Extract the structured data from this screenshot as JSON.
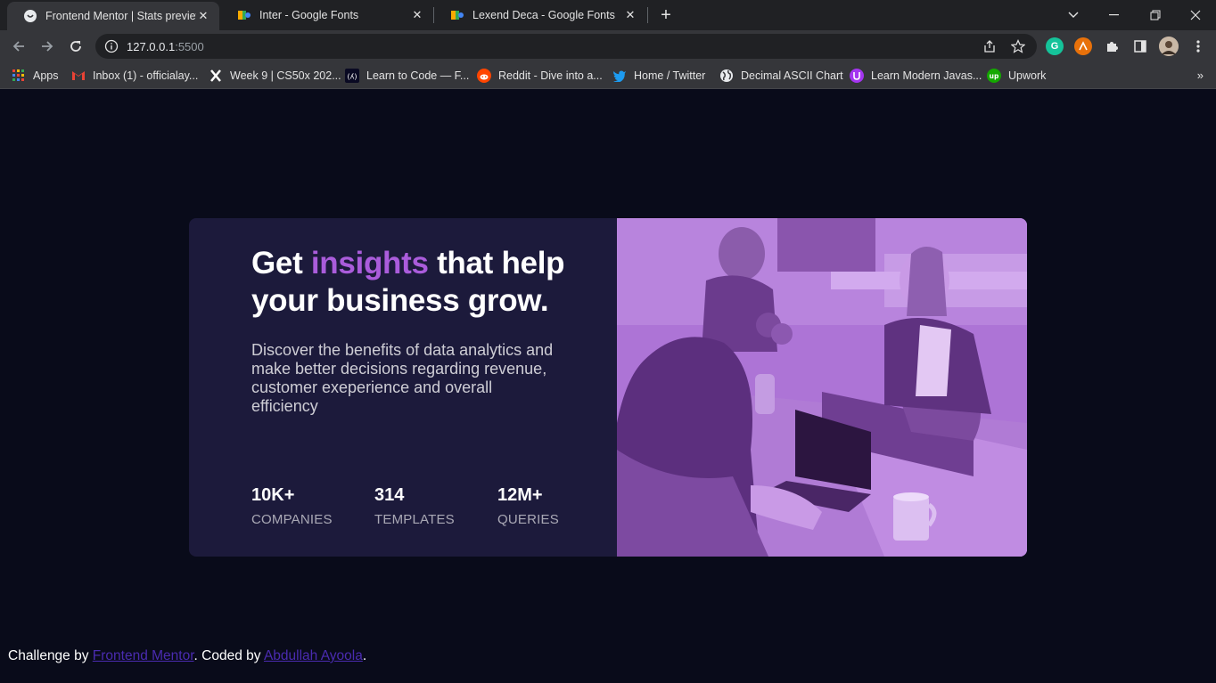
{
  "browser": {
    "tabs": [
      {
        "title": "Frontend Mentor | Stats preview c",
        "active": true,
        "favicon": "frontend-mentor-icon"
      },
      {
        "title": "Inter - Google Fonts",
        "active": false,
        "favicon": "google-fonts-icon"
      },
      {
        "title": "Lexend Deca - Google Fonts",
        "active": false,
        "favicon": "google-fonts-icon"
      }
    ],
    "url_host": "127.0.0.1",
    "url_port": ":5500",
    "bookmarks": [
      {
        "label": "Apps",
        "icon": "apps-grid-icon"
      },
      {
        "label": "Inbox (1) - officialay...",
        "icon": "gmail-icon"
      },
      {
        "label": "Week 9 | CS50x 202...",
        "icon": "x-icon"
      },
      {
        "label": "Learn to Code — F...",
        "icon": "freecodecamp-icon"
      },
      {
        "label": "Reddit - Dive into a...",
        "icon": "reddit-icon"
      },
      {
        "label": "Home / Twitter",
        "icon": "twitter-icon"
      },
      {
        "label": "Decimal ASCII Chart",
        "icon": "globe-icon"
      },
      {
        "label": "Learn Modern Javas...",
        "icon": "javascript-course-icon"
      },
      {
        "label": "Upwork",
        "icon": "upwork-icon"
      }
    ],
    "extensions": {
      "grammarly": "G",
      "profile": "avatar"
    }
  },
  "card": {
    "headline_pre": "Get ",
    "headline_accent": "insights",
    "headline_post": " that help your business grow.",
    "description": "Discover the benefits of data analytics and make better decisions regarding revenue, customer exeperience and overall efficiency",
    "stats": [
      {
        "value": "10K+",
        "label": "COMPANIES"
      },
      {
        "value": "314",
        "label": "TEMPLATES"
      },
      {
        "value": "12M+",
        "label": "QUERIES"
      }
    ],
    "colors": {
      "background": "#090b1a",
      "card": "#1c1a3b",
      "accent": "#aa5cdb",
      "overlay": "#a96fd3"
    }
  },
  "footer": {
    "prefix": "Challenge by ",
    "link1": "Frontend Mentor",
    "middle": ". Coded by ",
    "link2": "Abdullah Ayoola",
    "suffix": "."
  }
}
